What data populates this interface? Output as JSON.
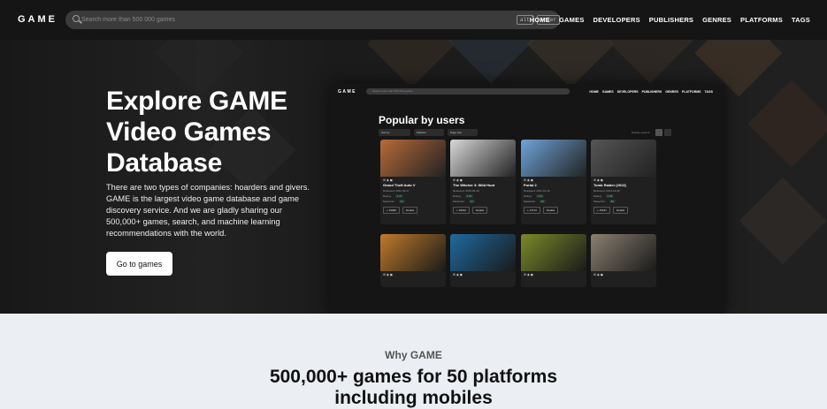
{
  "app": {
    "logo": "GAME"
  },
  "search": {
    "placeholder": "Search more than 500 000 games",
    "kbd_alt": "alt",
    "kbd_plus": "+",
    "kbd_enter": "enter"
  },
  "nav": [
    "HOME",
    "GAMES",
    "DEVELOPERS",
    "PUBLISHERS",
    "GENRES",
    "PLATFORMS",
    "TAGS"
  ],
  "hero": {
    "title": "Explore GAME Video Games Database",
    "description": "There are two types of companies: hoarders and givers. GAME is the largest video game database and game discovery service. And we are gladly sharing our 500,000+ games, search, and machine learning recommendations with the world.",
    "cta": "Go to games"
  },
  "preview": {
    "logo": "GAME",
    "search_placeholder": "Search more than 500 000 games",
    "nav": [
      "HOME",
      "GAMES",
      "DEVELOPERS",
      "PUBLISHERS",
      "GENRES",
      "PLATFORMS",
      "TAGS"
    ],
    "title": "Popular by users",
    "filters": [
      "Sort by",
      "Platform",
      "Page size"
    ],
    "display_label": "Display options",
    "cards": [
      {
        "platforms": "⊞ ◉ ◼",
        "name": "Grand Theft Auto V",
        "released": "Released: 2013-09-17",
        "rating": "4.47",
        "metacritic": "92",
        "count": "+ 19080",
        "details": "Details",
        "color": "#b86a3a"
      },
      {
        "platforms": "⊞ ◉ ◼",
        "name": "The Witcher 3: Wild Hunt",
        "released": "Released: 2015-05-18",
        "rating": "4.66",
        "metacritic": "92",
        "count": "+ 18232",
        "details": "Details",
        "color": "#d8d8d8"
      },
      {
        "platforms": "⊞ ◉ ◼",
        "name": "Portal 2",
        "released": "Released: 2011-04-18",
        "rating": "4.62",
        "metacritic": "95",
        "count": "+ 17172",
        "details": "Details",
        "color": "#6ea4d8"
      },
      {
        "platforms": "⊞ ◉ ◼",
        "name": "Tomb Raider (2013)",
        "released": "Released: 2013-03-05",
        "rating": "4.05",
        "metacritic": "86",
        "count": "+ 15047",
        "details": "Details",
        "color": "#555555"
      }
    ],
    "cards_row2": [
      {
        "platforms": "⊞ ◉ ◼",
        "color": "#c07a2a"
      },
      {
        "platforms": "⊞ ◉ ◼",
        "color": "#1f6aa0"
      },
      {
        "platforms": "⊞ ◉ ◼",
        "color": "#7a8a2a"
      },
      {
        "platforms": "⊞ ◉ ◼",
        "color": "#8a8070"
      }
    ]
  },
  "why": {
    "eyebrow": "Why GAME",
    "headline_1": "500,000+ games for 50 platforms",
    "headline_2": "including mobiles"
  }
}
